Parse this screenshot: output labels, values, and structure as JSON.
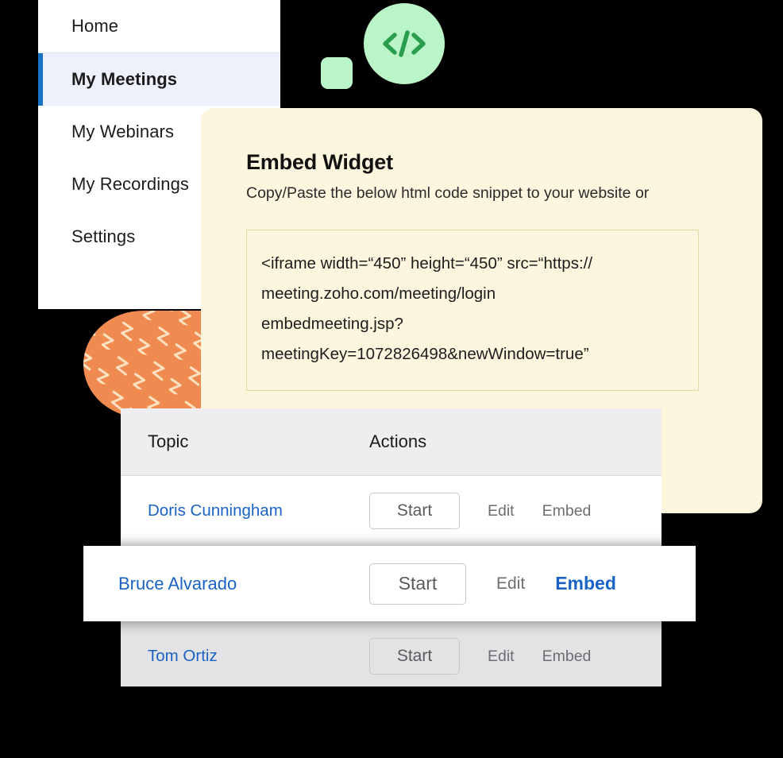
{
  "sidebar": {
    "items": [
      {
        "label": "Home",
        "active": false
      },
      {
        "label": "My Meetings",
        "active": true
      },
      {
        "label": "My Webinars",
        "active": false
      },
      {
        "label": "My Recordings",
        "active": false
      },
      {
        "label": "Settings",
        "active": false
      }
    ]
  },
  "decor": {
    "code_icon": "code-brackets-icon",
    "code_icon_glyph": "</>",
    "green": "#b9f5c6",
    "green_dark": "#2a9d4f",
    "orange": "#ef8b50",
    "orange_zigzag": "#fde3c2"
  },
  "embed_widget": {
    "title": "Embed Widget",
    "subtitle": "Copy/Paste the below html code snippet to your website or",
    "code_lines": [
      "<iframe width=“450” height=“450” src=“https://",
      "meeting.zoho.com/meeting/login",
      "embedmeeting.jsp?",
      "meetingKey=1072826498&newWindow=true”"
    ],
    "card_bg": "#fbf6dd",
    "code_border": "#e2d9a7"
  },
  "table": {
    "columns": [
      "Topic",
      "Actions"
    ],
    "header_bg": "#eeeef0",
    "rows": [
      {
        "topic": "Doris Cunningham",
        "start_label": "Start",
        "edit_label": "Edit",
        "embed_label": "Embed",
        "state": "normal"
      },
      {
        "topic": "Tom Ortiz",
        "start_label": "Start",
        "edit_label": "Edit",
        "embed_label": "Embed",
        "state": "dim"
      }
    ],
    "highlighted_row": {
      "topic": "Bruce Alvarado",
      "start_label": "Start",
      "edit_label": "Edit",
      "embed_label": "Embed",
      "embed_active": true
    },
    "link_color": "#1a63c4",
    "muted_color": "#6e6e72"
  }
}
